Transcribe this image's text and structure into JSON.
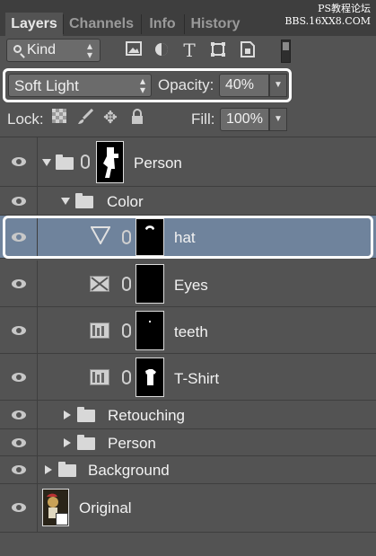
{
  "tabs": [
    "Layers",
    "Channels",
    "Info",
    "History"
  ],
  "watermark": {
    "line1": "PS教程论坛",
    "line2": "BBS.16XX8.COM"
  },
  "filter": {
    "kind_label": "Kind",
    "icons": [
      "image-filter-icon",
      "adjustment-filter-icon",
      "type-filter-icon",
      "shape-filter-icon",
      "smart-object-filter-icon"
    ]
  },
  "blend": {
    "mode": "Soft Light",
    "opacity_label": "Opacity:",
    "opacity_value": "40%"
  },
  "lock": {
    "label": "Lock:",
    "fill_label": "Fill:",
    "fill_value": "100%"
  },
  "layers": [
    {
      "name": "Person",
      "type": "group-expanded"
    },
    {
      "name": "Color",
      "type": "group-expanded"
    },
    {
      "name": "hat",
      "type": "adjustment-selected"
    },
    {
      "name": "Eyes",
      "type": "adjustment"
    },
    {
      "name": "teeth",
      "type": "adjustment"
    },
    {
      "name": "T-Shirt",
      "type": "adjustment"
    },
    {
      "name": "Retouching",
      "type": "group-collapsed"
    },
    {
      "name": "Person",
      "type": "group-collapsed"
    },
    {
      "name": "Background",
      "type": "group-collapsed"
    },
    {
      "name": "Original",
      "type": "pixel"
    }
  ]
}
